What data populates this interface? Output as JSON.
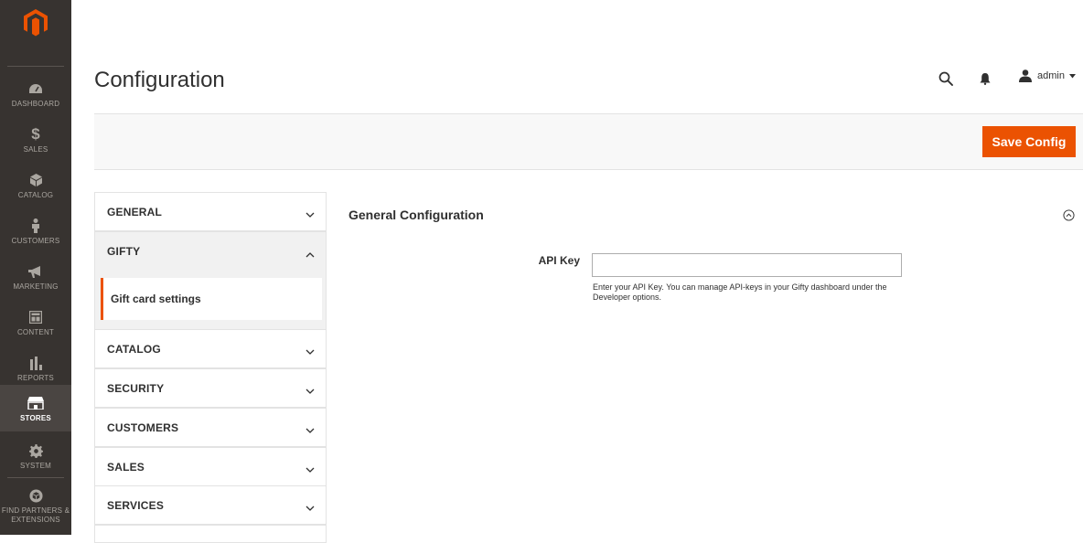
{
  "sidebar": {
    "items": [
      {
        "label": "DASHBOARD",
        "icon": "speedometer-icon"
      },
      {
        "label": "SALES",
        "icon": "dollar-icon"
      },
      {
        "label": "CATALOG",
        "icon": "cube-icon"
      },
      {
        "label": "CUSTOMERS",
        "icon": "person-icon"
      },
      {
        "label": "MARKETING",
        "icon": "megaphone-icon"
      },
      {
        "label": "CONTENT",
        "icon": "layout-icon"
      },
      {
        "label": "REPORTS",
        "icon": "bar-chart-icon"
      },
      {
        "label": "STORES",
        "icon": "storefront-icon",
        "active": true
      },
      {
        "label": "SYSTEM",
        "icon": "gear-icon"
      },
      {
        "label": "FIND PARTNERS & EXTENSIONS",
        "icon": "box-icon"
      }
    ]
  },
  "header": {
    "title": "Configuration",
    "user": "admin"
  },
  "toolbar": {
    "save_label": "Save Config"
  },
  "tabs": {
    "general": "GENERAL",
    "gifty": "GIFTY",
    "gifty_sub": "Gift card settings",
    "catalog": "CATALOG",
    "security": "SECURITY",
    "customers": "CUSTOMERS",
    "sales": "SALES",
    "services": "SERVICES"
  },
  "section": {
    "title": "General Configuration",
    "api_key_label": "API Key",
    "api_key_value": "",
    "api_key_note": "Enter your API Key. You can manage API-keys in your Gifty dashboard under the Developer options."
  },
  "colors": {
    "accent": "#eb5202",
    "sidebar_bg": "#373330"
  }
}
